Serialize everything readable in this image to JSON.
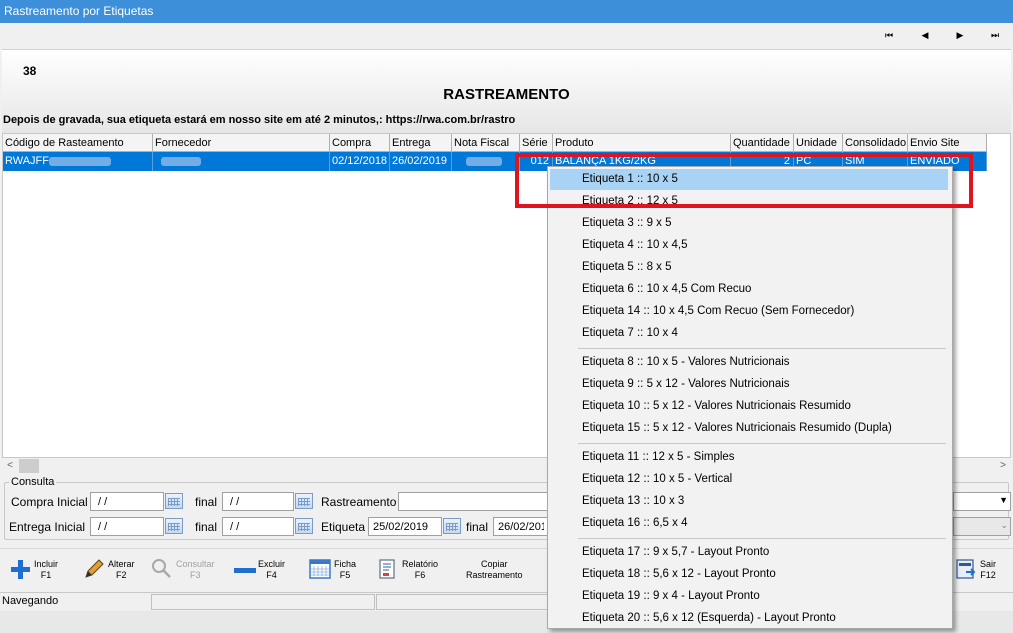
{
  "window": {
    "title": "Rastreamento por Etiquetas"
  },
  "nav": {
    "first": "⏮",
    "prev": "◀",
    "next": "▶",
    "last": "⏭"
  },
  "header": {
    "record_number": "38",
    "title": "RASTREAMENTO",
    "info": "Depois de gravada, sua etiqueta estará em nosso site em até 2 minutos,: https://rwa.com.br/rastro"
  },
  "grid": {
    "columns": [
      "Código de Rasteamento",
      "Fornecedor",
      "Compra",
      "Entrega",
      "Nota Fiscal",
      "Série",
      "Produto",
      "Quantidade",
      "Unidade",
      "Consolidado",
      "Envio Site"
    ],
    "row": {
      "codigo": "RWAJFF",
      "compra": "02/12/2018",
      "entrega": "26/02/2019",
      "serie": "012",
      "produto": "BALANÇA 1KG/2KG",
      "quantidade": "2",
      "unidade": "PC",
      "consolidado": "SIM",
      "envio": "ENVIADO"
    }
  },
  "consulta": {
    "legend": "Consulta",
    "compra_inicial_label": "Compra Inicial",
    "compra_inicial_value": " / /",
    "final_label": "final",
    "compra_final_value": " / /",
    "rastreamento_label": "Rastreamento",
    "entrega_inicial_label": "Entrega Inicial",
    "entrega_inicial_value": " / /",
    "entrega_final_value": " / /",
    "etiqueta_label": "Etiqueta",
    "etiqueta_value": "25/02/2019",
    "etiqueta_final_value": "26/02/2019"
  },
  "toolbar": {
    "incluir": [
      "Incluir",
      "F1"
    ],
    "alterar": [
      "Alterar",
      "F2"
    ],
    "consultar": [
      "Consultar",
      "F3"
    ],
    "excluir": [
      "Excluir",
      "F4"
    ],
    "ficha": [
      "Ficha",
      "F5"
    ],
    "relatorio": [
      "Relatório",
      "F6"
    ],
    "copiar": [
      "Copiar",
      "Rastreamento"
    ],
    "sair": [
      "Sair",
      "F12"
    ]
  },
  "status": {
    "text": "Navegando"
  },
  "context_menu": {
    "items": [
      "Etiqueta 1 :: 10 x 5",
      "Etiqueta 2 :: 12 x 5",
      "Etiqueta 3 :: 9 x 5",
      "Etiqueta 4 :: 10 x 4,5",
      "Etiqueta 5 :: 8 x 5",
      "Etiqueta 6 :: 10 x 4,5 Com Recuo",
      "Etiqueta 14 :: 10 x 4,5 Com Recuo (Sem Fornecedor)",
      "Etiqueta 7 :: 10 x 4",
      "Etiqueta 8 :: 10 x 5 - Valores Nutricionais",
      "Etiqueta 9 :: 5 x 12 - Valores Nutricionais",
      "Etiqueta 10 :: 5 x 12 - Valores Nutricionais Resumido",
      "Etiqueta 15 :: 5 x 12 - Valores Nutricionais Resumido (Dupla)",
      "Etiqueta 11 :: 12 x 5 - Simples",
      "Etiqueta 12 :: 10 x 5 - Vertical",
      "Etiqueta 13 :: 10 x 3",
      "Etiqueta 16 :: 6,5 x 4",
      "Etiqueta 17 :: 9 x 5,7 - Layout Pronto",
      "Etiqueta 18 :: 5,6 x 12 - Layout Pronto",
      "Etiqueta 19 :: 9 x 4 - Layout Pronto",
      "Etiqueta 20 :: 5,6 x 12 (Esquerda) - Layout Pronto"
    ],
    "selected": "Etiqueta 1 :: 10 x 5"
  },
  "colors": {
    "accent": "#0078d7",
    "highlight": "#e0141e",
    "menu_selected": "#a9d3f5"
  }
}
